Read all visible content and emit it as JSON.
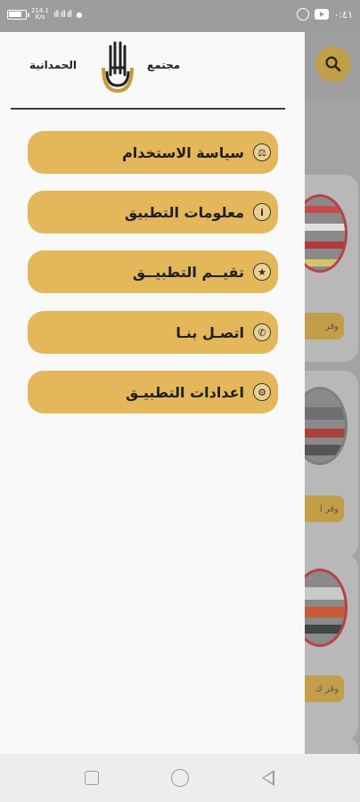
{
  "status_bar": {
    "speed_value": "214.1",
    "speed_unit": "K/s",
    "signal_text": "ıll ıll ıll",
    "time": "٠:٤١"
  },
  "drawer": {
    "brand_word_right": "مجتمع",
    "brand_word_left": "الحمدانية",
    "menu": [
      {
        "label": "سياسة الاستخدام",
        "icon": "scale-icon",
        "glyph": "⚖"
      },
      {
        "label": "معلومات التطبيق",
        "icon": "info-icon",
        "glyph": "i"
      },
      {
        "label": "تقيــم التطبيــق",
        "icon": "star-icon",
        "glyph": "★"
      },
      {
        "label": "اتصـل بنـا",
        "icon": "phone-icon",
        "glyph": "✆"
      },
      {
        "label": "اعدادات التطبيـق",
        "icon": "settings-icon",
        "glyph": "⚙"
      }
    ]
  },
  "background": {
    "card_button_label": "وقر",
    "card_button_label_2": "وقر ا",
    "card_button_label_3": "وقر ك"
  },
  "colors": {
    "accent": "#e3b75a",
    "accent_dim": "#c39e49",
    "drawer_bg": "#f9f9f9"
  }
}
